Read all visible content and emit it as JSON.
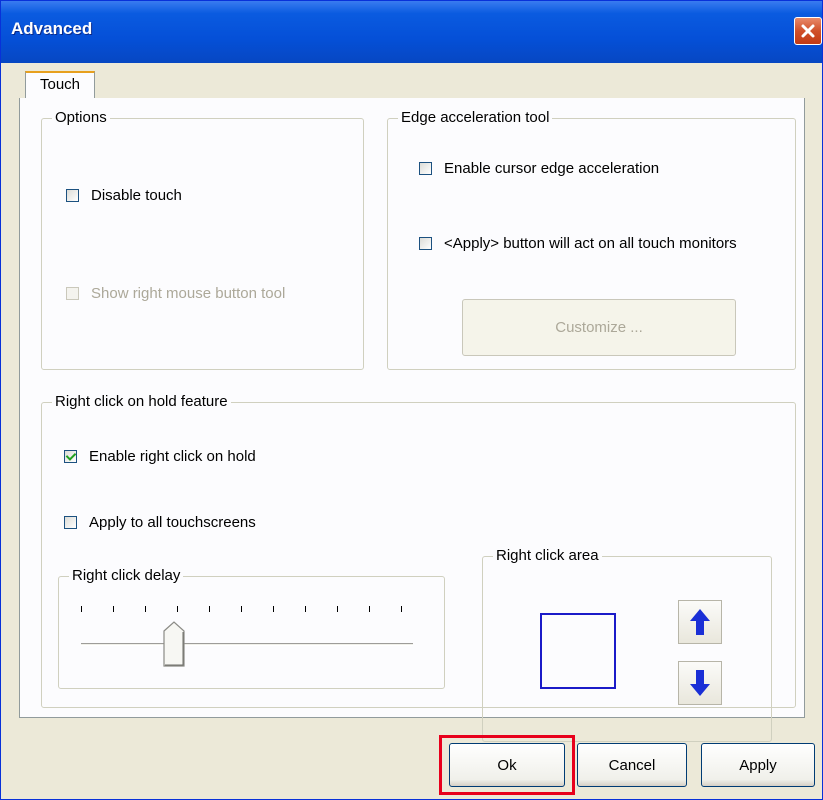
{
  "window": {
    "title": "Advanced",
    "close_icon": "close-icon"
  },
  "tabs": [
    {
      "label": "Touch",
      "selected": true
    }
  ],
  "options_group": {
    "legend": "Options",
    "disable_touch": {
      "label": "Disable touch",
      "checked": false
    },
    "show_right_mouse": {
      "label": "Show right mouse button tool",
      "checked": false,
      "enabled": false
    }
  },
  "edge_group": {
    "legend": "Edge acceleration tool",
    "enable_edge": {
      "label": "Enable cursor edge acceleration",
      "checked": false
    },
    "apply_all_monitors": {
      "label": "<Apply> button will act on all touch monitors",
      "checked": false
    },
    "customize_label": "Customize ..."
  },
  "right_click_group": {
    "legend": "Right click on hold feature",
    "enable_hold": {
      "label": "Enable right click on hold",
      "checked": true
    },
    "apply_all_screens": {
      "label": "Apply to all touchscreens",
      "checked": false
    },
    "delay": {
      "legend": "Right click delay",
      "tick_count": 11,
      "position": 0.29
    },
    "area": {
      "legend": "Right click area",
      "increase_icon": "arrow-up-icon",
      "decrease_icon": "arrow-down-icon"
    }
  },
  "footer": {
    "ok_label": "Ok",
    "cancel_label": "Cancel",
    "apply_label": "Apply"
  },
  "colors": {
    "titlebar": "#0550d8",
    "close_button": "#d0502a",
    "arrow": "#1a2fd6",
    "highlight": "#e8001c"
  }
}
